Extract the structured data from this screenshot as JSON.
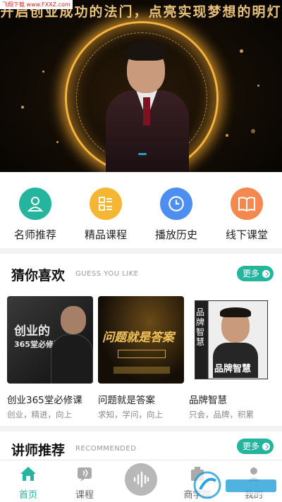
{
  "watermark": "飞翔下载 www.FXXZ.com",
  "banner": {
    "headline": "开启创业成功的法门，点亮实现梦想的明灯"
  },
  "shortcuts": [
    {
      "label": "名师推荐",
      "icon": "teacher-icon",
      "color": "#25b59e"
    },
    {
      "label": "精品课程",
      "icon": "list-icon",
      "color": "#f5b731"
    },
    {
      "label": "播放历史",
      "icon": "clock-icon",
      "color": "#4d8ff0"
    },
    {
      "label": "线下课堂",
      "icon": "book-icon",
      "color": "#f4894f"
    }
  ],
  "guess": {
    "title": "猜你喜欢",
    "subtitle": "GUESS YOU LIKE",
    "more": "更多",
    "items": [
      {
        "title": "创业365堂必修课",
        "tags": "创业，精进，向上",
        "cover_text": "创业的\n365堂必修课"
      },
      {
        "title": "问题就是答案",
        "tags": "求知，学问，向上",
        "cover_text": "问题就是答案"
      },
      {
        "title": "品牌智慧",
        "tags": "只会，品牌，积累",
        "cover_text": "品牌智慧"
      }
    ]
  },
  "teachers": {
    "title": "讲师推荐",
    "subtitle": "RECOMMENDED",
    "more": "更多"
  },
  "tabs": [
    {
      "label": "首页",
      "icon": "home-icon",
      "active": true
    },
    {
      "label": "课程",
      "icon": "course-icon",
      "active": false
    },
    {
      "label": "",
      "icon": "audio-wave-icon",
      "active": false
    },
    {
      "label": "商学院",
      "icon": "school-icon",
      "active": false
    },
    {
      "label": "我的",
      "icon": "profile-icon",
      "active": false
    }
  ],
  "colors": {
    "accent": "#25b59e",
    "banner_gold": "#e8c27a"
  }
}
